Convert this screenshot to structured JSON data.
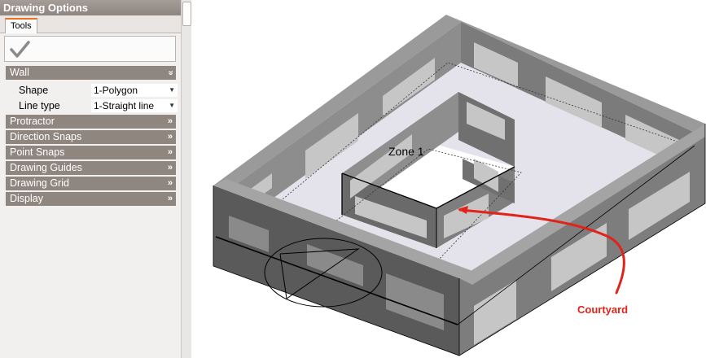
{
  "panel": {
    "title": "Drawing Options",
    "tab": "Tools"
  },
  "wall": {
    "header": "Wall",
    "header_chevron": "»",
    "shape_label": "Shape",
    "shape_value": "1-Polygon",
    "linetype_label": "Line type",
    "linetype_value": "1-Straight line"
  },
  "sections": [
    {
      "label": "Protractor",
      "chevron": "»"
    },
    {
      "label": "Direction Snaps",
      "chevron": "»"
    },
    {
      "label": "Point Snaps",
      "chevron": "»"
    },
    {
      "label": "Drawing Guides",
      "chevron": "»"
    },
    {
      "label": "Drawing Grid",
      "chevron": "»"
    },
    {
      "label": "Display",
      "chevron": "»"
    }
  ],
  "viewport": {
    "zone_label": "Zone 1",
    "annotation": "Courtyard"
  },
  "colors": {
    "header_bg": "#8f877f",
    "title_bg": "#a59d97",
    "tab_accent": "#e8731c",
    "annotation": "#e2231a"
  }
}
